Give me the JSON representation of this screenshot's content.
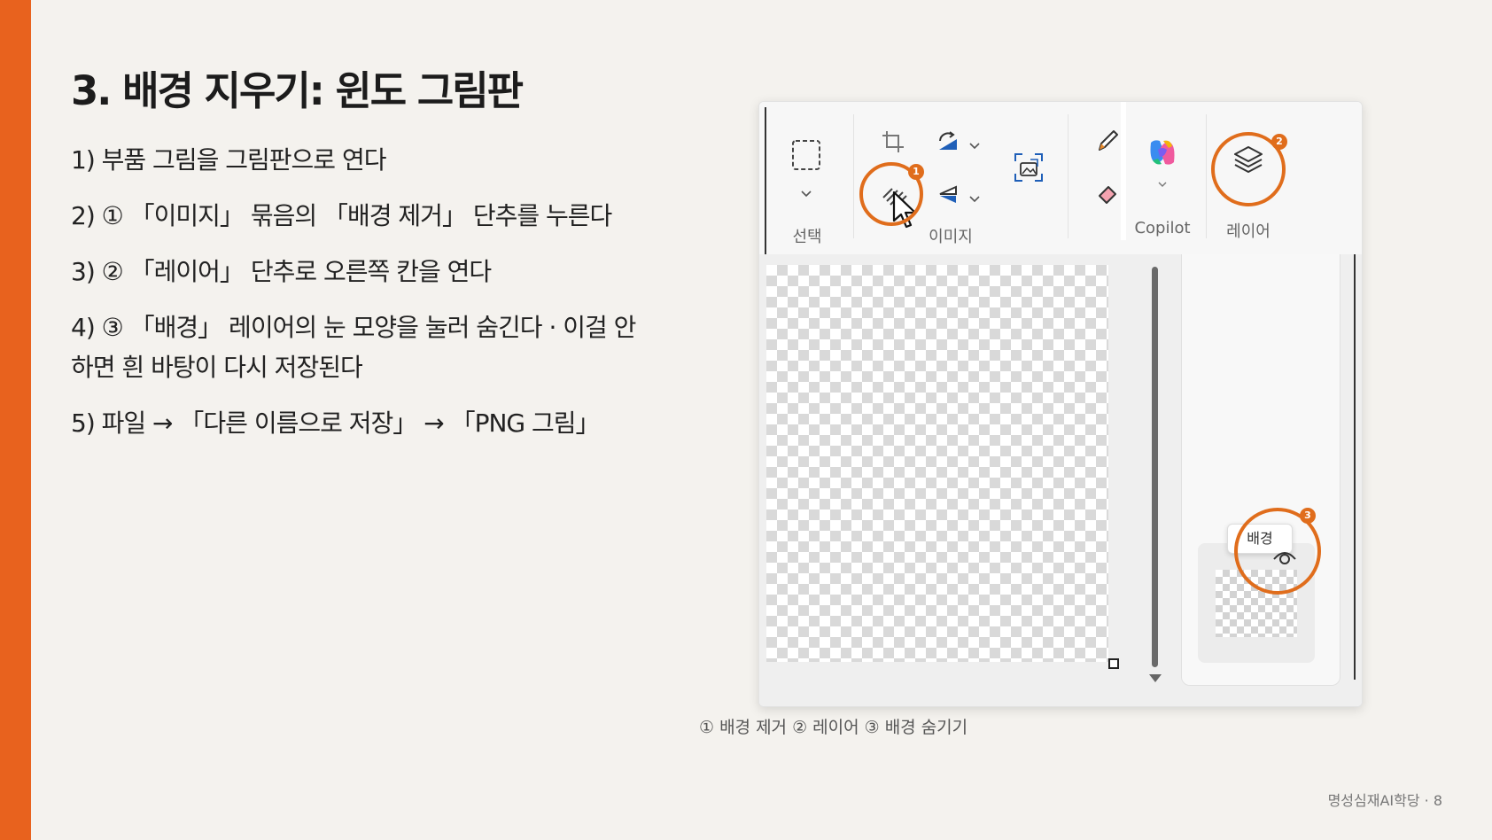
{
  "slide": {
    "title": "3. 배경 지우기: 윈도 그림판",
    "steps": [
      {
        "lines": [
          "1) 부품 그림을 그림판으로 연다"
        ]
      },
      {
        "lines": [
          "2) ① 「이미지」 묶음의 「배경 제거」 단추를 누른다"
        ]
      },
      {
        "lines": [
          "3) ② 「레이어」 단추로 오른쪽 칸을 연다"
        ]
      },
      {
        "lines": [
          "4) ③ 「배경」 레이어의 눈 모양을 눌러 숨긴다 · 이걸 안",
          "하면 흰 바탕이 다시 저장된다"
        ]
      },
      {
        "lines": [
          "5) 파일 → 「다른 이름으로 저장」 → 「PNG 그림」"
        ]
      }
    ],
    "caption": "① 배경 제거 ② 레이어 ③ 배경 숨기기",
    "footer": "명성심재AI학당 · 8"
  },
  "screenshot": {
    "toolbar": {
      "select_label": "선택",
      "image_label": "이미지",
      "copilot_label": "Copilot",
      "layers_label": "레이어",
      "badges": [
        "1",
        "2",
        "3"
      ]
    },
    "layer_tooltip": "배경"
  },
  "colors": {
    "accent": "#e8621e",
    "ring": "#e06d1c",
    "background": "#f4f2ee"
  }
}
